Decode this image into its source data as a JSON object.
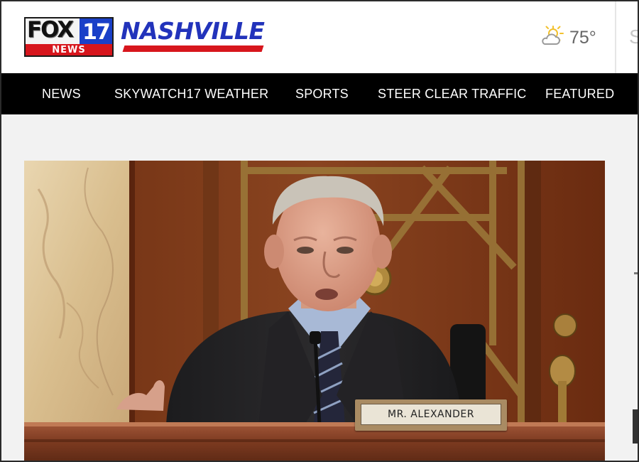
{
  "brand": {
    "fox": "FOX",
    "number": "17",
    "news": "NEWS",
    "city": "NASHVILLE",
    "colors": {
      "blue": "#1a40c8",
      "red": "#d7161d",
      "navy": "#2233bb"
    }
  },
  "weather": {
    "icon": "partly-cloudy-icon",
    "temperature": "75°",
    "next_cut": "S"
  },
  "nav": {
    "items": [
      {
        "label": "NEWS"
      },
      {
        "label": "SKYWATCH17 WEATHER"
      },
      {
        "label": "SPORTS"
      },
      {
        "label": "STEER CLEAR TRAFFIC"
      },
      {
        "label": "FEATURED"
      }
    ]
  },
  "hero": {
    "placard": "MR. ALEXANDER"
  }
}
